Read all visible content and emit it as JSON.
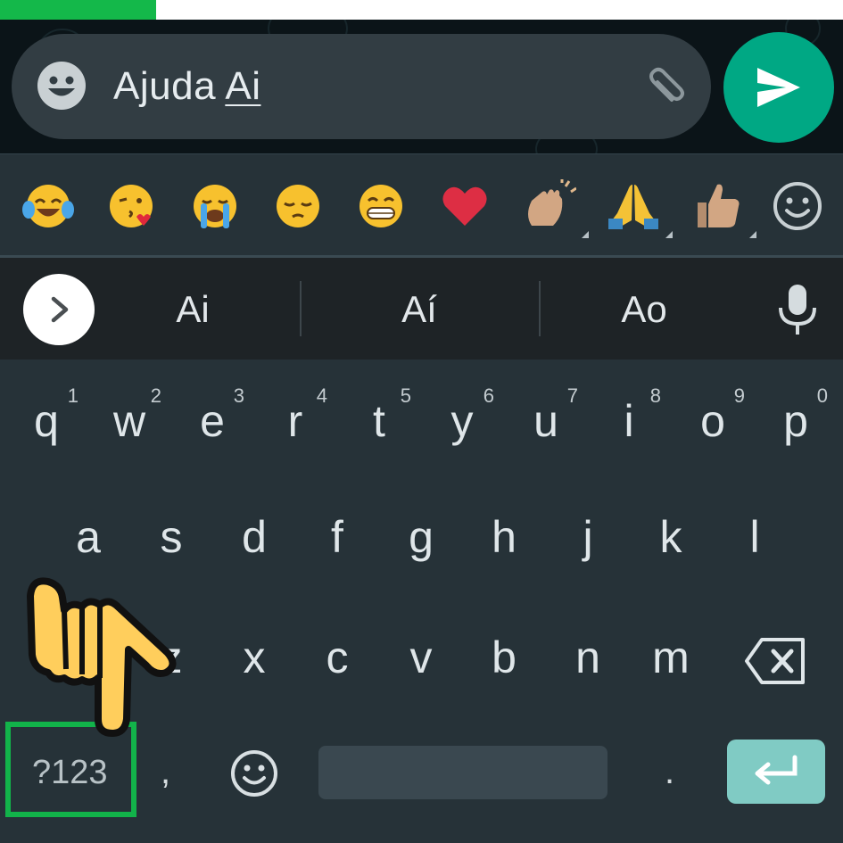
{
  "progress": {
    "value": 0.185,
    "color": "#14b84a"
  },
  "composer": {
    "text_main": "Ajuda ",
    "text_underlined": "Ai",
    "emoji_icon": "smiley-face-icon",
    "attach_icon": "paperclip-icon",
    "send_icon": "send-arrow-icon",
    "send_color": "#00a884"
  },
  "emoji_bar": {
    "items": [
      {
        "name": "face-with-tears-of-joy-icon",
        "has_variants": false
      },
      {
        "name": "kissing-face-with-heart-icon",
        "has_variants": false
      },
      {
        "name": "loudly-crying-face-icon",
        "has_variants": false
      },
      {
        "name": "pensive-face-icon",
        "has_variants": false
      },
      {
        "name": "grinning-face-icon",
        "has_variants": false
      },
      {
        "name": "red-heart-icon",
        "has_variants": false
      },
      {
        "name": "clapping-hands-icon",
        "has_variants": true
      },
      {
        "name": "folded-hands-icon",
        "has_variants": true
      },
      {
        "name": "thumbs-up-icon",
        "has_variants": true
      }
    ],
    "more_icon": "smiley-outline-icon"
  },
  "suggestions": {
    "expand_icon": "chevron-right-icon",
    "items": [
      "Ai",
      "Aí",
      "Ao"
    ],
    "mic_icon": "microphone-icon"
  },
  "keyboard": {
    "row1": [
      {
        "key": "q",
        "hint": "1"
      },
      {
        "key": "w",
        "hint": "2"
      },
      {
        "key": "e",
        "hint": "3"
      },
      {
        "key": "r",
        "hint": "4"
      },
      {
        "key": "t",
        "hint": "5"
      },
      {
        "key": "y",
        "hint": "6"
      },
      {
        "key": "u",
        "hint": "7"
      },
      {
        "key": "i",
        "hint": "8"
      },
      {
        "key": "o",
        "hint": "9"
      },
      {
        "key": "p",
        "hint": "0"
      }
    ],
    "row2": [
      "a",
      "s",
      "d",
      "f",
      "g",
      "h",
      "j",
      "k",
      "l"
    ],
    "row3": [
      "z",
      "x",
      "c",
      "v",
      "b",
      "n",
      "m"
    ],
    "backspace_icon": "backspace-icon",
    "symbols_label": "?123",
    "comma": ",",
    "emoji_key_icon": "smiley-outline-icon",
    "period": ".",
    "enter_icon": "enter-arrow-icon",
    "highlight_color": "#12b34a"
  },
  "overlay": {
    "hand_icon": "pointing-hand-icon"
  }
}
